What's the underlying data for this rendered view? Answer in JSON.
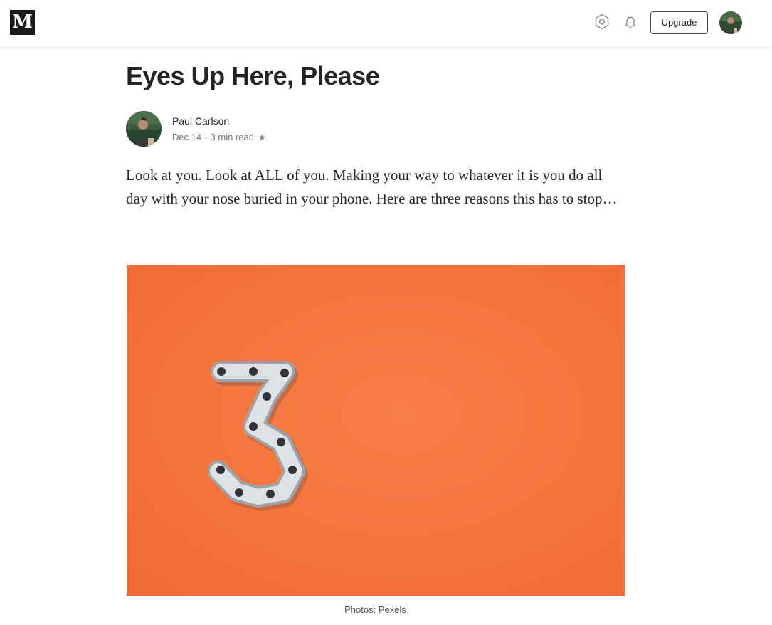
{
  "header": {
    "logo_letter": "M",
    "upgrade_label": "Upgrade",
    "icons": [
      "settings-icon",
      "bell-icon"
    ]
  },
  "article": {
    "title": "Eyes Up Here, Please",
    "author": {
      "name": "Paul Carlson",
      "date": "Dec 14",
      "separator": "·",
      "read_time": "3 min read",
      "member_star": "★"
    },
    "intro": "Look at you. Look at ALL of you. Making your way to whatever it is you do all day with your nose buried in your phone. Here are three reasons this has to stop…",
    "image": {
      "subject": "bike chain shaped as the number 3 on orange background",
      "background_color": "#f5733f"
    },
    "caption": "Photos: Pexels"
  }
}
